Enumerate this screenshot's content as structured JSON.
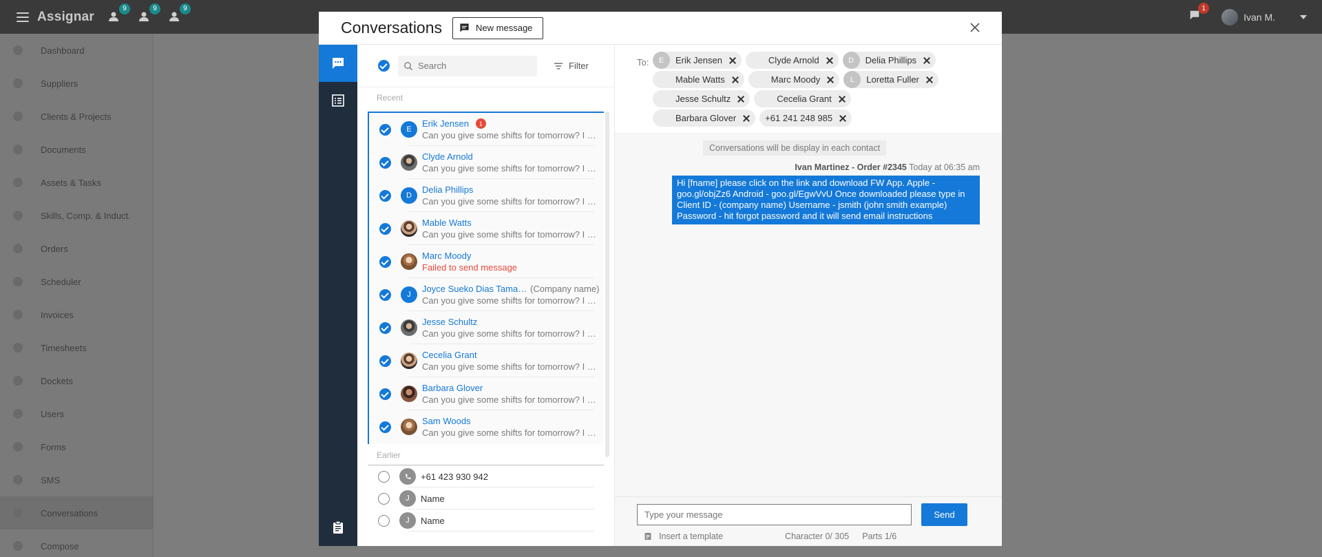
{
  "topbar": {
    "logo": "Assignar",
    "badges": [
      "9",
      "9",
      "9"
    ],
    "chat_badge": "1",
    "user_name": "Ivan M."
  },
  "nav": {
    "items": [
      "Dashboard",
      "Suppliers",
      "Clients & Projects",
      "Documents",
      "Assets & Tasks",
      "Skills, Comp. & Induct.",
      "Orders",
      "Scheduler",
      "Invoices",
      "Timesheets",
      "Dockets",
      "Users",
      "Forms",
      "SMS",
      "Conversations",
      "Compose"
    ],
    "active": "Conversations"
  },
  "modal": {
    "title": "Conversations",
    "new_message_label": "New message"
  },
  "list": {
    "search_placeholder": "Search",
    "filter_label": "Filter",
    "recent_label": "Recent",
    "earlier_label": "Earlier",
    "recent": [
      {
        "initial": "E",
        "name": "Erik Jensen",
        "badge": "1",
        "preview": "Can you give some shifts for tomorrow? I need it urgently"
      },
      {
        "initial": "",
        "name": "Clyde Arnold",
        "preview": "Can you give some shifts for tomorrow? I need it urgently"
      },
      {
        "initial": "D",
        "name": "Delia Phillips",
        "preview": "Can you give some shifts for tomorrow? I need it urgently"
      },
      {
        "initial": "",
        "name": "Mable Watts",
        "preview": "Can you give some shifts for tomorrow? I need it urgently"
      },
      {
        "initial": "",
        "name": "Marc Moody",
        "preview": "Failed to send message"
      },
      {
        "initial": "J",
        "name": "Joyce Sueko Dias Tamachiro",
        "company": "(Company name)",
        "preview": "Can you give some shifts for tomorrow? I need it urgently"
      },
      {
        "initial": "",
        "name": "Jesse Schultz",
        "preview": "Can you give some shifts for tomorrow? I need it urgently"
      },
      {
        "initial": "",
        "name": "Cecelia Grant",
        "preview": "Can you give some shifts for tomorrow? I need it urgently"
      },
      {
        "initial": "",
        "name": "Barbara Glover",
        "preview": "Can you give some shifts for tomorrow? I need it urgently"
      },
      {
        "initial": "",
        "name": "Sam Woods",
        "preview": "Can you give some shifts for tomorrow? I need it urgently"
      }
    ],
    "earlier": [
      {
        "initial": "",
        "name": "+61 423 930 942"
      },
      {
        "initial": "J",
        "name": "Name"
      },
      {
        "initial": "J",
        "name": "Name"
      }
    ]
  },
  "recipients": {
    "to_label": "To:",
    "chips": [
      {
        "initial": "E",
        "name": "Erik Jensen"
      },
      {
        "initial": "",
        "name": "Clyde Arnold"
      },
      {
        "initial": "D",
        "name": "Delia Phillips"
      },
      {
        "initial": "",
        "name": "Mable Watts"
      },
      {
        "initial": "",
        "name": "Marc Moody"
      },
      {
        "initial": "L",
        "name": "Loretta Fuller"
      },
      {
        "initial": "",
        "name": "Jesse Schultz"
      },
      {
        "initial": "",
        "name": "Cecelia Grant"
      },
      {
        "initial": "",
        "name": "Barbara Glover"
      },
      {
        "initial": "",
        "name": "+61 241 248 985"
      }
    ]
  },
  "messages": {
    "info": "Conversations will be display in each contact",
    "sender": "Ivan Martinez - Order #2345",
    "time": "Today at 06:35 am",
    "body": "Hi [fname] please click on the link and download FW App. Apple - goo.gl/objZz6 Android - goo.gl/EgwVvU Once downloaded please type in Client ID - (company name) Username - jsmith (john smith example) Password - hit forgot password and it will send email instructions"
  },
  "compose": {
    "placeholder": "Type your message",
    "send_label": "Send",
    "template_label": "Insert a template",
    "characters": "Character 0/ 305",
    "parts": "Parts 1/6"
  },
  "colors": {
    "accent": "#1479d8",
    "rail": "#1f2d3d",
    "alert": "#e8493a"
  }
}
